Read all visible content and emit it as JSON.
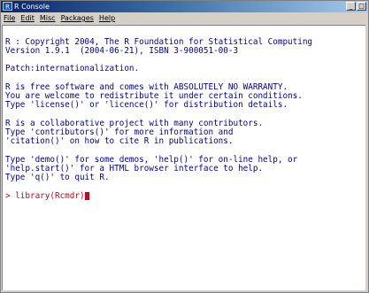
{
  "window": {
    "title": "R Console",
    "title_buttons": [
      "_",
      "□"
    ]
  },
  "menubar": {
    "items": [
      "File",
      "Edit",
      "Misc",
      "Packages",
      "Help"
    ]
  },
  "console": {
    "lines": [
      "",
      "R : Copyright 2004, The R Foundation for Statistical Computing",
      "Version 1.9.1  (2004-06-21), ISBN 3-900051-00-3",
      "",
      "Patch:internationalization.",
      "",
      "R is free software and comes with ABSOLUTELY NO WARRANTY.",
      "You are welcome to redistribute it under certain conditions.",
      "Type 'license()' or 'licence()' for distribution details.",
      "",
      "R is a collaborative project with many contributors.",
      "Type 'contributors()' for more information and",
      "'citation()' on how to cite R in publications.",
      "",
      "Type 'demo()' for some demos, 'help()' for on-line help, or",
      "'help.start()' for a HTML browser interface to help.",
      "Type 'q()' to quit R.",
      ""
    ],
    "prompt": "> library(Rcmdr)",
    "text_color": "#0000a8",
    "prompt_color": "#d0001a"
  }
}
